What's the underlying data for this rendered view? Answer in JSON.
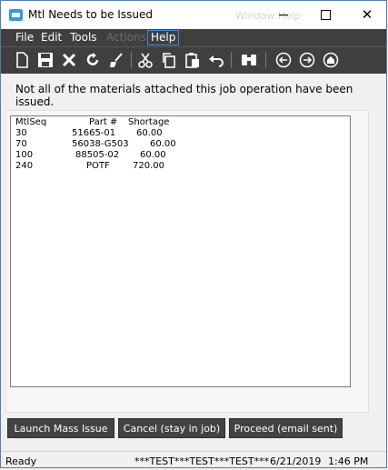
{
  "window": {
    "title": "Mtl Needs to be Issued",
    "ghost_title": "Window Help",
    "minimize_icon": "minimize-icon",
    "maximize_icon": "maximize-icon",
    "close_glyph": "✕"
  },
  "menu": {
    "file": "File",
    "edit": "Edit",
    "tools": "Tools",
    "actions": "Actions",
    "help": "Help"
  },
  "toolbar": {
    "icons": [
      "new-icon",
      "save-icon",
      "delete-icon",
      "refresh-icon",
      "clear-icon",
      "cut-icon",
      "copy-icon",
      "paste-icon",
      "undo-icon",
      "search-icon",
      "back-icon",
      "forward-icon",
      "home-icon"
    ]
  },
  "message": "Not all of the materials attached  this job operation have  been issued.",
  "table": {
    "headers": {
      "mtlseq": "MtlSeq",
      "part": "Part #",
      "shortage": "Shortage"
    },
    "rows": [
      {
        "mtlseq": "30",
        "part": "51665-01",
        "shortage": "60.00"
      },
      {
        "mtlseq": "70",
        "part": "56038-G503",
        "shortage": "60.00"
      },
      {
        "mtlseq": "100",
        "part": "88505-02",
        "shortage": "60.00"
      },
      {
        "mtlseq": "240",
        "part": "POTF",
        "shortage": "720.00"
      }
    ]
  },
  "buttons": {
    "mass_issue": "Launch Mass Issue",
    "cancel": "Cancel (stay in job)",
    "proceed": "Proceed (email sent)"
  },
  "status": {
    "state": "Ready",
    "test": "***TEST***TEST***TEST***",
    "date": "6/21/2019",
    "time": "1:46 PM"
  },
  "colors": {
    "menubar": "#3f3f3f",
    "button": "#434343",
    "accent": "#2b9fd8"
  }
}
